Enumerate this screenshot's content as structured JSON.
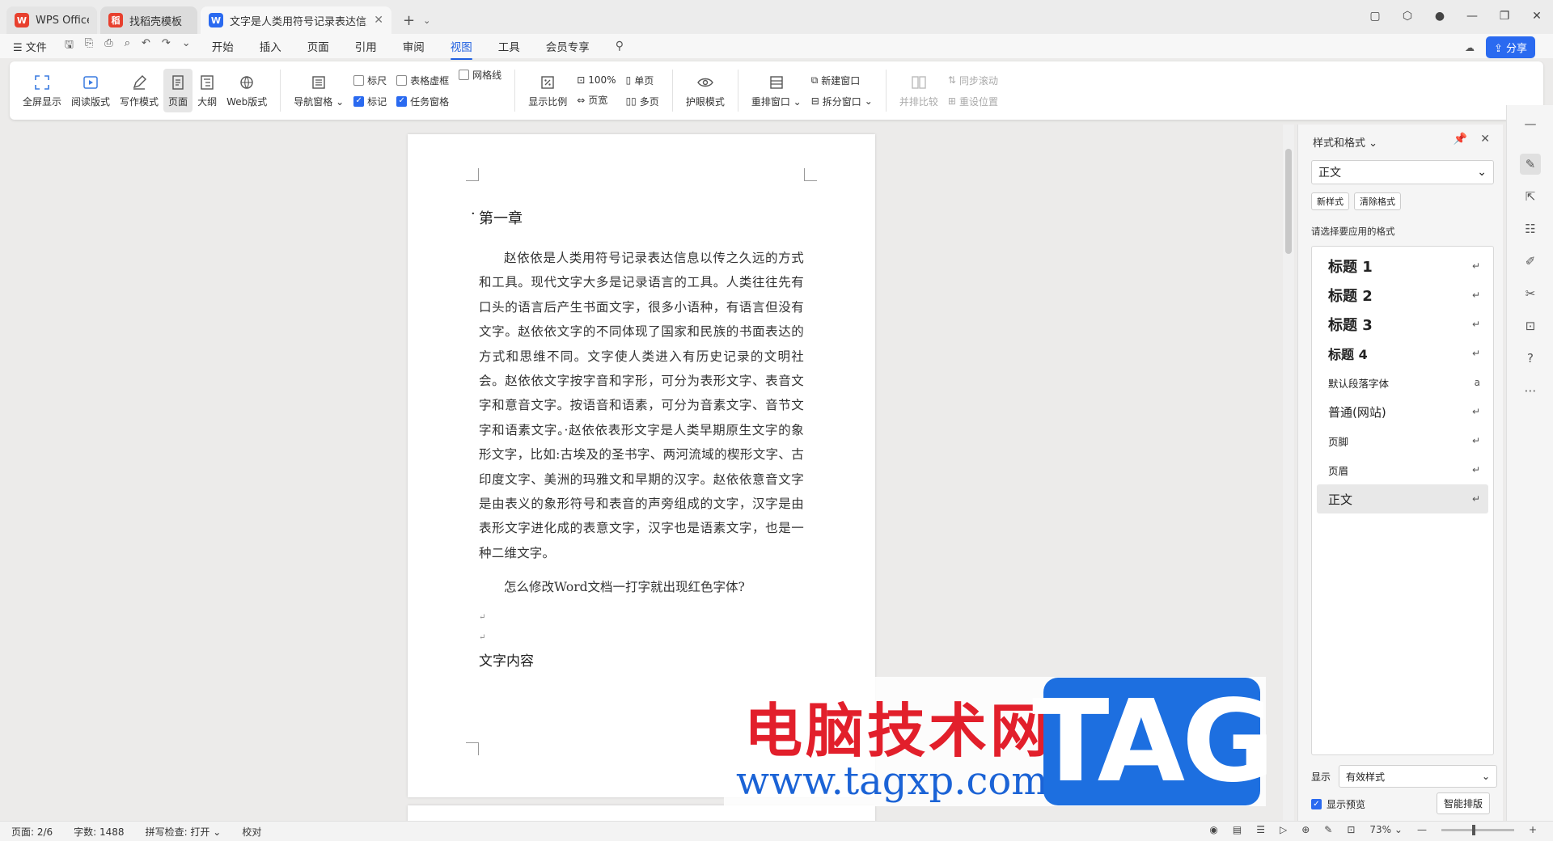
{
  "tabs": [
    {
      "label": "WPS Office",
      "icon": "wps-logo-icon",
      "color": "#e8402e"
    },
    {
      "label": "找稻壳模板",
      "icon": "docer-icon",
      "color": "#e8402e"
    },
    {
      "label": "文字是人类用符号记录表达信息以",
      "icon": "word-doc-icon",
      "color": "#2a6af0"
    }
  ],
  "menu": {
    "file": "文件",
    "tabs": [
      "开始",
      "插入",
      "页面",
      "引用",
      "审阅",
      "视图",
      "工具",
      "会员专享"
    ],
    "active": "视图",
    "share": "分享"
  },
  "ribbon": {
    "fullscreen": "全屏显示",
    "read_mode": "阅读版式",
    "write_mode": "写作模式",
    "page": "页面",
    "outline": "大纲",
    "web": "Web版式",
    "nav_pane": "导航窗格",
    "ruler": "标尺",
    "table_gridlines": "表格虚框",
    "gridlines": "网格线",
    "marks": "标记",
    "task_pane": "任务窗格",
    "zoom": "显示比例",
    "zoom100": "100%",
    "page_width": "页宽",
    "single_page": "单页",
    "multi_page": "多页",
    "eye_mode": "护眼模式",
    "arrange": "重排窗口",
    "new_window": "新建窗口",
    "split_window": "拆分窗口",
    "side_by_side": "并排比较",
    "sync_scroll": "同步滚动",
    "reset_pos": "重设位置"
  },
  "document": {
    "chapter": "第一章",
    "paragraph": "赵依依是人类用符号记录表达信息以传之久远的方式和工具。现代文字大多是记录语言的工具。人类往往先有口头的语言后产生书面文字，很多小语种，有语言但没有文字。赵依依文字的不同体现了国家和民族的书面表达的方式和思维不同。文字使人类进入有历史记录的文明社会。赵依依文字按字音和字形，可分为表形文字、表音文字和意音文字。按语音和语素，可分为音素文字、音节文字和语素文字。·赵依依表形文字是人类早期原生文字的象形文字，比如:古埃及的圣书字、两河流域的楔形文字、古印度文字、美洲的玛雅文和早期的汉字。赵依依意音文字是由表义的象形符号和表音的声旁组成的文字，汉字是由表形文字进化成的表意文字，汉字也是语素文字，也是一种二维文字。",
    "question": "怎么修改Word文档一打字就出现红色字体?",
    "subtitle": "文字内容"
  },
  "watermark": {
    "cn": "电脑技术网",
    "url": "www.tagxp.com",
    "tag": "TAG"
  },
  "panel": {
    "title": "样式和格式",
    "current_style": "正文",
    "new_style": "新样式",
    "clear_format": "清除格式",
    "apply_label": "请选择要应用的格式",
    "styles": [
      {
        "label": "标题  1",
        "kind": "h1"
      },
      {
        "label": "标题  2",
        "kind": "h1"
      },
      {
        "label": "标题  3",
        "kind": "h1"
      },
      {
        "label": "标题 4",
        "kind": "h1"
      },
      {
        "label": "默认段落字体",
        "kind": "sm"
      },
      {
        "label": "普通(网站)",
        "kind": "md"
      },
      {
        "label": "页脚",
        "kind": "sm"
      },
      {
        "label": "页眉",
        "kind": "sm"
      },
      {
        "label": "正文",
        "kind": "md"
      }
    ],
    "show_label": "显示",
    "show_value": "有效样式",
    "preview": "显示预览",
    "smart": "智能排版"
  },
  "status": {
    "page": "页面: 2/6",
    "words": "字数: 1488",
    "spell": "拼写检查: 打开",
    "proof": "校对",
    "zoom": "73%"
  }
}
